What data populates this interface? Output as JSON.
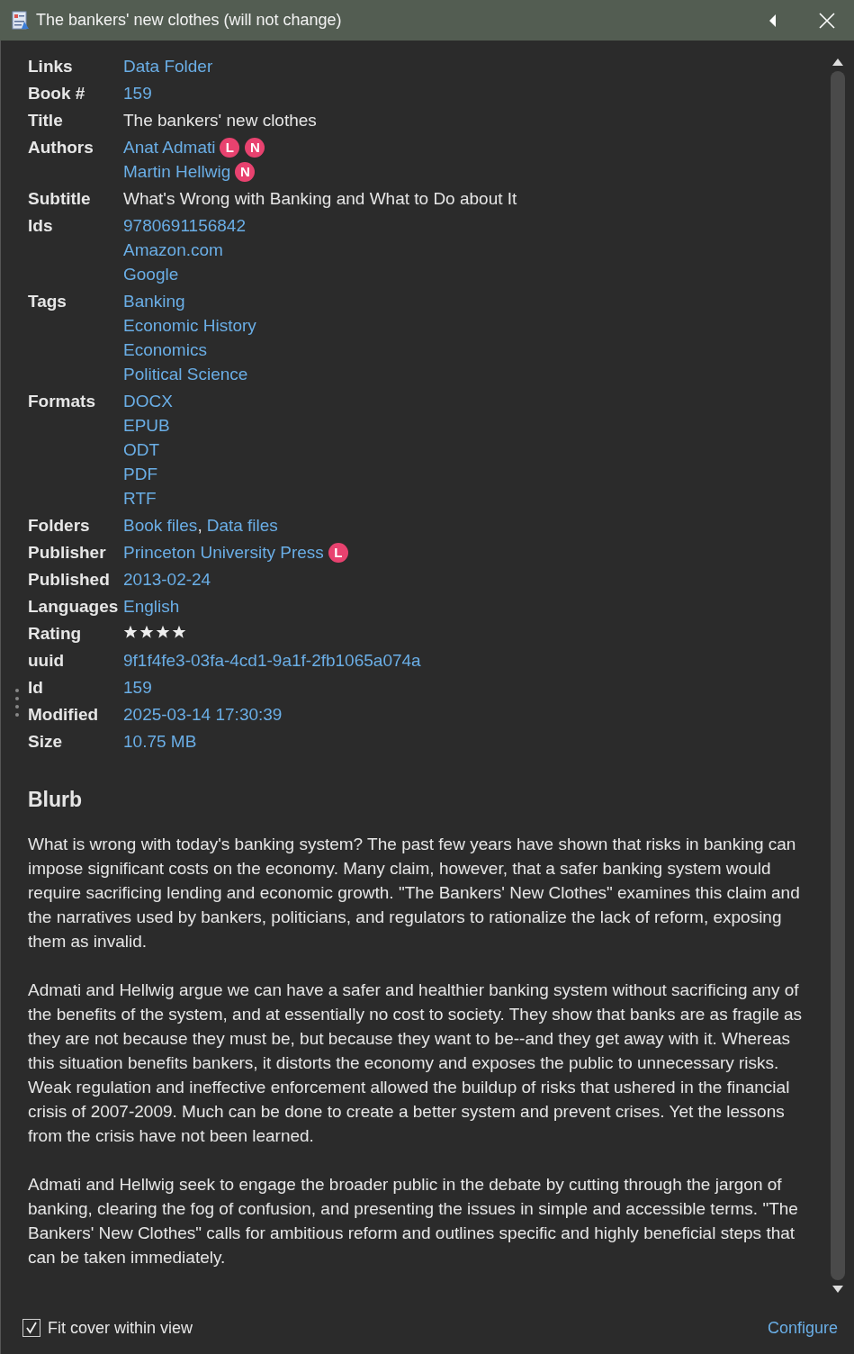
{
  "window": {
    "title": "The bankers' new clothes (will not change)"
  },
  "fields": [
    {
      "label": "Links",
      "lines": [
        {
          "segments": [
            {
              "text": "Data Folder",
              "link": true
            }
          ]
        }
      ]
    },
    {
      "label": "Book #",
      "lines": [
        {
          "segments": [
            {
              "text": "159",
              "link": true
            }
          ]
        }
      ]
    },
    {
      "label": "Title",
      "lines": [
        {
          "segments": [
            {
              "text": "The bankers' new clothes",
              "link": false
            }
          ]
        }
      ]
    },
    {
      "label": "Authors",
      "lines": [
        {
          "segments": [
            {
              "text": "Anat Admati",
              "link": true
            }
          ],
          "badges": [
            "L",
            "N"
          ]
        },
        {
          "segments": [
            {
              "text": "Martin Hellwig",
              "link": true
            }
          ],
          "badges": [
            "N"
          ]
        }
      ]
    },
    {
      "label": "Subtitle",
      "lines": [
        {
          "segments": [
            {
              "text": "What's Wrong with Banking and What to Do about It",
              "link": false
            }
          ]
        }
      ]
    },
    {
      "label": "Ids",
      "lines": [
        {
          "segments": [
            {
              "text": "9780691156842",
              "link": true
            }
          ]
        },
        {
          "segments": [
            {
              "text": "Amazon.com",
              "link": true
            }
          ]
        },
        {
          "segments": [
            {
              "text": "Google",
              "link": true
            }
          ]
        }
      ]
    },
    {
      "label": "Tags",
      "lines": [
        {
          "segments": [
            {
              "text": "Banking",
              "link": true
            }
          ]
        },
        {
          "segments": [
            {
              "text": "Economic History",
              "link": true
            }
          ]
        },
        {
          "segments": [
            {
              "text": "Economics",
              "link": true
            }
          ]
        },
        {
          "segments": [
            {
              "text": "Political Science",
              "link": true
            }
          ]
        }
      ]
    },
    {
      "label": "Formats",
      "lines": [
        {
          "segments": [
            {
              "text": "DOCX",
              "link": true
            }
          ]
        },
        {
          "segments": [
            {
              "text": "EPUB",
              "link": true
            }
          ]
        },
        {
          "segments": [
            {
              "text": "ODT",
              "link": true
            }
          ]
        },
        {
          "segments": [
            {
              "text": "PDF",
              "link": true
            }
          ]
        },
        {
          "segments": [
            {
              "text": "RTF",
              "link": true
            }
          ]
        }
      ]
    },
    {
      "label": "Folders",
      "lines": [
        {
          "segments": [
            {
              "text": "Book files",
              "link": true
            },
            {
              "text": ",",
              "link": false
            },
            {
              "text": "Data files",
              "link": true
            }
          ]
        }
      ]
    },
    {
      "label": "Publisher",
      "lines": [
        {
          "segments": [
            {
              "text": "Princeton University Press",
              "link": true
            }
          ],
          "badges": [
            "L"
          ]
        }
      ]
    },
    {
      "label": "Published",
      "lines": [
        {
          "segments": [
            {
              "text": "2013-02-24",
              "link": true
            }
          ]
        }
      ]
    },
    {
      "label": "Languages",
      "lines": [
        {
          "segments": [
            {
              "text": "English",
              "link": true
            }
          ]
        }
      ]
    },
    {
      "label": "Rating",
      "lines": [
        {
          "stars": 4
        }
      ]
    },
    {
      "label": "uuid",
      "lines": [
        {
          "segments": [
            {
              "text": "9f1f4fe3-03fa-4cd1-9a1f-2fb1065a074a",
              "link": true
            }
          ]
        }
      ]
    },
    {
      "label": "Id",
      "lines": [
        {
          "segments": [
            {
              "text": "159",
              "link": true
            }
          ]
        }
      ]
    },
    {
      "label": "Modified",
      "lines": [
        {
          "segments": [
            {
              "text": "2025-03-14 17:30:39",
              "link": true
            }
          ]
        }
      ]
    },
    {
      "label": "Size",
      "lines": [
        {
          "segments": [
            {
              "text": "10.75 MB",
              "link": true
            }
          ]
        }
      ]
    }
  ],
  "blurb": {
    "heading": "Blurb",
    "paragraphs": [
      "What is wrong with today's banking system? The past few years have shown that risks in banking can impose significant costs on the economy. Many claim, however, that a safer banking system would require sacrificing lending and economic growth. \"The Bankers' New Clothes\" examines this claim and the narratives used by bankers, politicians, and regulators to rationalize the lack of reform, exposing them as invalid.",
      "Admati and Hellwig argue we can have a safer and healthier banking system without sacrificing any of the benefits of the system, and at essentially no cost to society. They show that banks are as fragile as they are not because they must be, but because they want to be--and they get away with it. Whereas this situation benefits bankers, it distorts the economy and exposes the public to unnecessary risks. Weak regulation and ineffective enforcement allowed the buildup of risks that ushered in the financial crisis of 2007-2009. Much can be done to create a better system and prevent crises. Yet the lessons from the crisis have not been learned.",
      "Admati and Hellwig seek to engage the broader public in the debate by cutting through the jargon of banking, clearing the fog of confusion, and presenting the issues in simple and accessible terms. \"The Bankers' New Clothes\" calls for ambitious reform and outlines specific and highly beneficial steps that can be taken immediately."
    ]
  },
  "footer": {
    "checkbox": {
      "label": "Fit cover within view",
      "checked": true
    },
    "link": "Configure"
  }
}
